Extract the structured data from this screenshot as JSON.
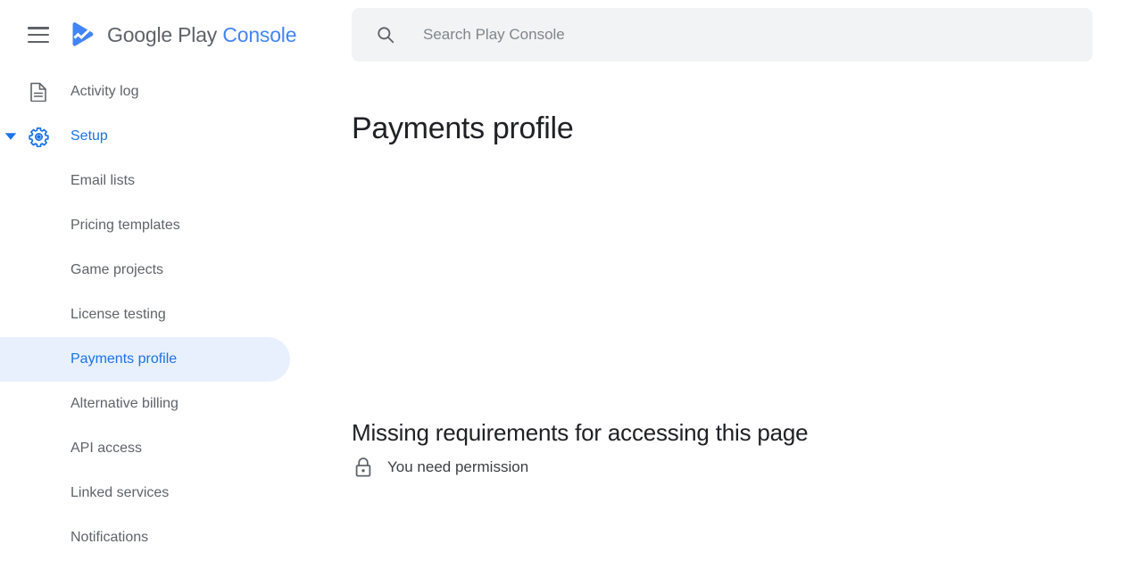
{
  "brand": {
    "name_primary": "Google Play",
    "name_secondary": "Console",
    "logo_icon": "play-console-logo",
    "menu_icon": "hamburger-menu-icon",
    "accent_color": "#4285f4",
    "logo_color": "#1a73e8"
  },
  "search": {
    "placeholder": "Search Play Console",
    "value": "",
    "icon": "search-icon",
    "background": "#f1f3f4"
  },
  "sidebar": {
    "items": [
      {
        "label": "Activity log",
        "icon": "document-icon",
        "level": "top",
        "active": false,
        "expandable": false
      },
      {
        "label": "Setup",
        "icon": "gear-icon",
        "level": "top",
        "active": false,
        "expandable": true,
        "expanded": true,
        "caret_icon": "caret-down-icon",
        "highlighted": true
      },
      {
        "label": "Email lists",
        "level": "child",
        "active": false
      },
      {
        "label": "Pricing templates",
        "level": "child",
        "active": false
      },
      {
        "label": "Game projects",
        "level": "child",
        "active": false
      },
      {
        "label": "License testing",
        "level": "child",
        "active": false
      },
      {
        "label": "Payments profile",
        "level": "child",
        "active": true
      },
      {
        "label": "Alternative billing",
        "level": "child",
        "active": false
      },
      {
        "label": "API access",
        "level": "child",
        "active": false
      },
      {
        "label": "Linked services",
        "level": "child",
        "active": false
      },
      {
        "label": "Notifications",
        "level": "child",
        "active": false
      }
    ],
    "active_pill_color": "#e8f0fe",
    "active_text_color": "#1a73e8",
    "text_color": "#5f6368"
  },
  "main": {
    "page_title": "Payments profile",
    "section_title": "Missing requirements for accessing this page",
    "requirements": [
      {
        "icon": "lock-icon",
        "text": "You need permission"
      }
    ]
  }
}
